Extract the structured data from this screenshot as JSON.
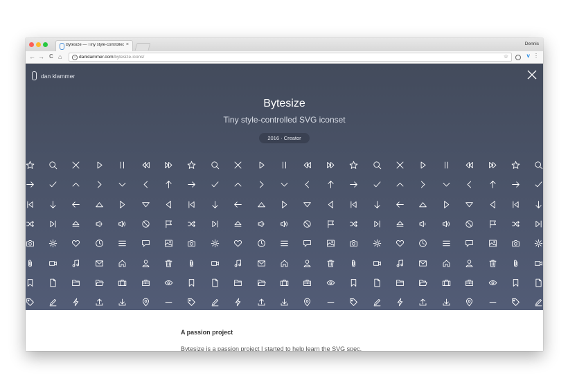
{
  "browser": {
    "tab_title": "Bytesize — Tiny style-controlled",
    "tab_close": "×",
    "profile_name": "Dennis",
    "url_domain": "danklammer.com",
    "url_path": "/bytesize-icons/",
    "nav": {
      "back": "←",
      "forward": "→",
      "reload": "C",
      "home": "⌂"
    }
  },
  "header": {
    "brand": "dan klammer"
  },
  "hero": {
    "title": "Bytesize",
    "subtitle": "Tiny style-controlled SVG iconset",
    "badge": "2016 · Creator"
  },
  "icon_rows": [
    [
      "star",
      "search",
      "close",
      "play",
      "pause",
      "rewind",
      "fastforward"
    ],
    [
      "arrow-right",
      "check",
      "chevron-top",
      "chevron-right",
      "chevron-bottom",
      "chevron-left",
      "arrow-top"
    ],
    [
      "start",
      "arrow-bottom",
      "arrow-left",
      "triangle-up",
      "triangle-right",
      "triangle-down",
      "triangle-left"
    ],
    [
      "shuffle",
      "end",
      "eject",
      "volume",
      "volume-loud",
      "ban",
      "flag"
    ],
    [
      "camera",
      "settings",
      "heart",
      "clock",
      "menu",
      "message",
      "photo"
    ],
    [
      "paperclip",
      "video",
      "music",
      "mail",
      "home",
      "user",
      "trash"
    ],
    [
      "bookmark",
      "file",
      "folder",
      "folder-open",
      "portfolio",
      "work",
      "eye"
    ],
    [
      "tag",
      "compose",
      "lightning",
      "upload",
      "download",
      "location",
      "minus"
    ]
  ],
  "content": {
    "heading": "A passion project",
    "text": "Bytesize is a passion project I started to help learn the SVG spec."
  },
  "colors": {
    "hero_top": "#434b5c",
    "hero_bottom": "#525c76",
    "badge_bg": "#3a4152",
    "icon_stroke": "#ffffff"
  }
}
